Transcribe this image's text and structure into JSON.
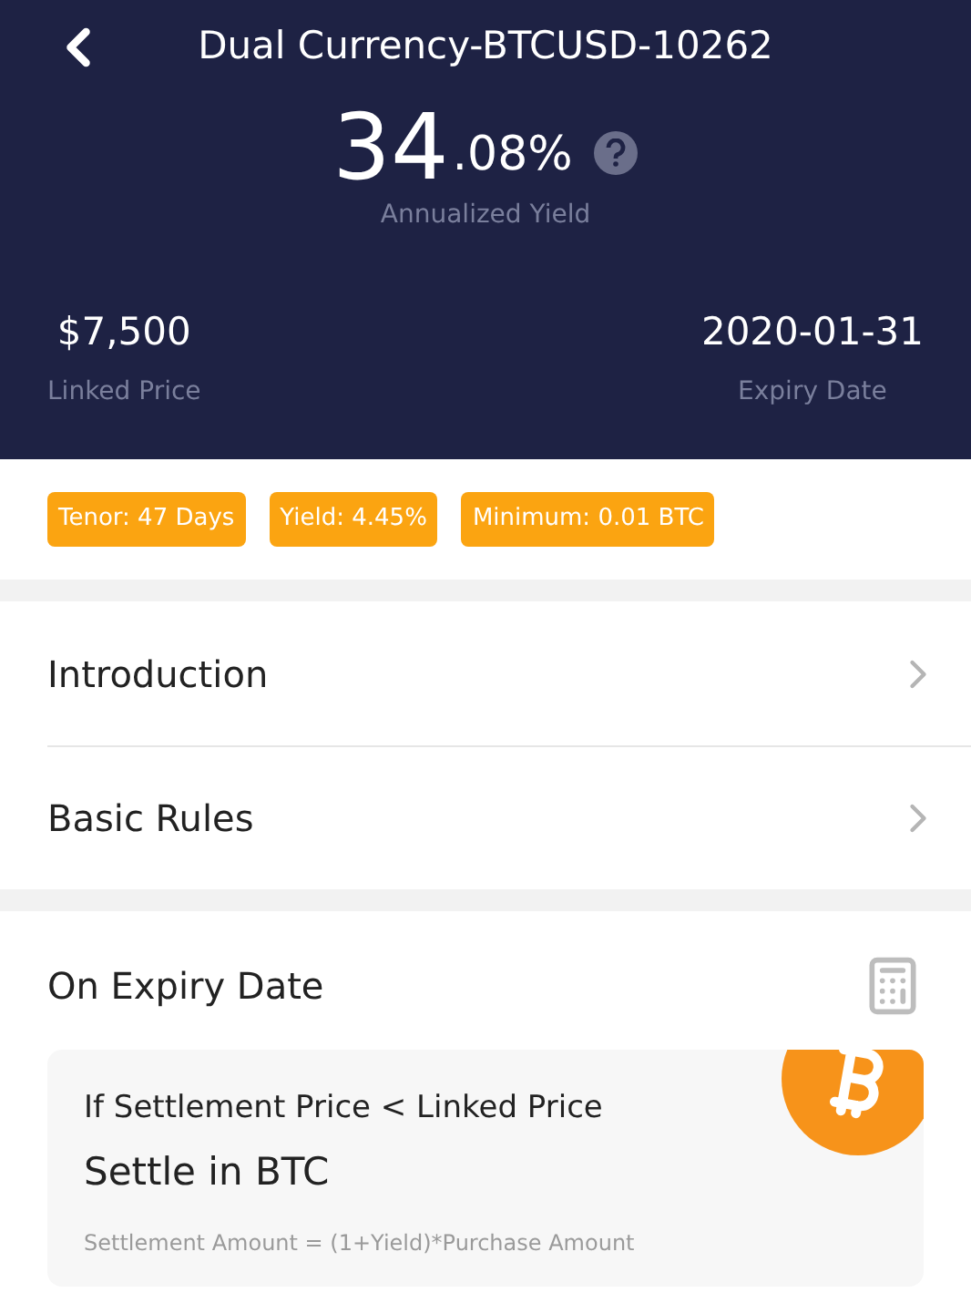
{
  "header": {
    "title": "Dual Currency-BTCUSD-10262",
    "yield_whole": "34",
    "yield_fraction": ".08%",
    "yield_label": "Annualized Yield",
    "stats": [
      {
        "value": "$7,500",
        "label": "Linked Price"
      },
      {
        "value": "2020-01-31",
        "label": "Expiry Date"
      }
    ]
  },
  "tags": [
    "Tenor: 47 Days",
    "Yield: 4.45%",
    "Minimum: 0.01 BTC"
  ],
  "menu": [
    "Introduction",
    "Basic Rules"
  ],
  "expiry": {
    "title": "On Expiry Date",
    "card": {
      "condition": "If Settlement Price < Linked Price",
      "result": "Settle in BTC",
      "formula": "Settlement Amount = (1+Yield)*Purchase Amount"
    }
  }
}
